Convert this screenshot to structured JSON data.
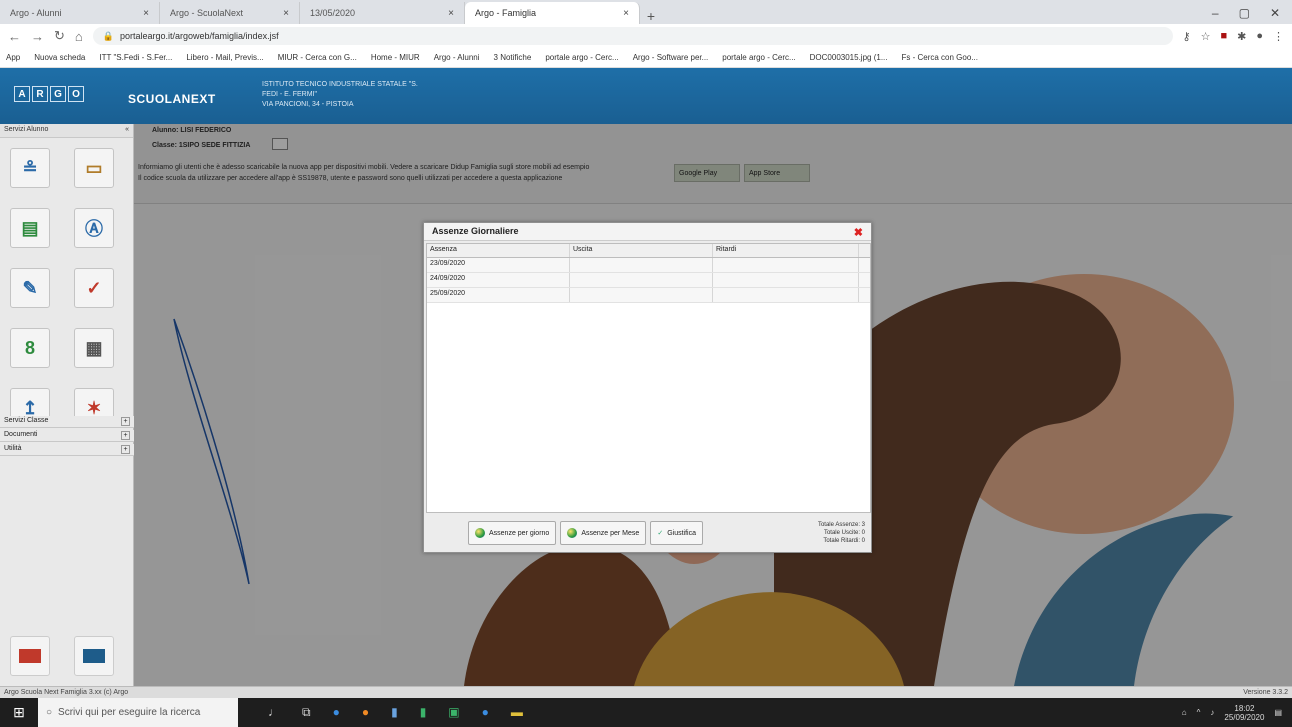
{
  "browser": {
    "tabs": [
      {
        "label": "Argo - Alunni",
        "active": false
      },
      {
        "label": "Argo - ScuolaNext",
        "active": false
      },
      {
        "label": "13/05/2020",
        "active": false
      },
      {
        "label": "Argo - Famiglia",
        "active": true
      }
    ],
    "new_tab": "+",
    "url": "portaleargo.it/argoweb/famiglia/index.jsf",
    "bookmarks": [
      "App",
      "Nuova scheda",
      "ITT \"S.Fedi - S.Fer...",
      "Libero - Mail, Previs...",
      "MIUR - Cerca con G...",
      "Home - MIUR",
      "Argo - Alunni",
      "3 Notifiche",
      "portale argo - Cerc...",
      "Argo - Software per...",
      "portale argo - Cerc...",
      "DOC0003015.jpg (1...",
      "Fs - Cerca con Goo..."
    ]
  },
  "app": {
    "logo_letters": [
      "A",
      "R",
      "G",
      "O"
    ],
    "brand": "SCUOLANEXT",
    "school_lines": [
      "ISTITUTO TECNICO INDUSTRIALE STATALE \"S.",
      "FEDI - E. FERMI\"",
      "VIA PANCIONI, 34 - PISTOIA"
    ]
  },
  "sidebar": {
    "header": "Servizi Alunno",
    "collapse": "«",
    "sections": [
      "Servizi Classe",
      "Documenti",
      "Utilità"
    ],
    "plus": "+"
  },
  "info": {
    "student": "Alunno: LISI FEDERICO",
    "class": "Classe: 1SIPO SEDE FITTIZIA",
    "line1": "Informiamo gli utenti che è adesso scaricabile la nuova app per dispositivi mobili. Vedere a scaricare Didup Famiglia sugli store mobili ad esempio",
    "line2": "Il codice scuola da utilizzare per accedere all'app è SS19878, utente e password sono quelli utilizzati per accedere a questa applicazione",
    "btn1": "Google Play",
    "btn2": "App Store"
  },
  "dialog": {
    "title": "Assenze Giornaliere",
    "close": "✖",
    "columns": [
      "Assenza",
      "Uscita",
      "Ritardi"
    ],
    "rows": [
      [
        "23/09/2020",
        "",
        ""
      ],
      [
        "24/09/2020",
        "",
        ""
      ],
      [
        "25/09/2020",
        "",
        ""
      ]
    ],
    "buttons": [
      "Assenze per giorno",
      "Assenze per Mese",
      "Giustifica"
    ],
    "totals": [
      "Totale Assenze: 3",
      "Totale Uscite: 0",
      "Totale Ritardi: 0"
    ]
  },
  "status": {
    "left": "Argo Scuola Next Famiglia 3.xx (c) Argo",
    "right": "Versione 3.3.2"
  },
  "taskbar": {
    "search_placeholder": "Scrivi qui per eseguire la ricerca",
    "time": "18:02",
    "date": "25/09/2020"
  }
}
